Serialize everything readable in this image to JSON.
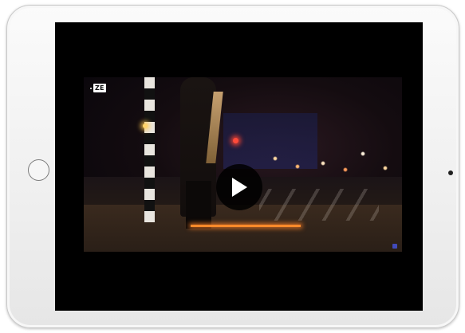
{
  "device": {
    "type": "tablet",
    "frame_color": "#f0f0f0",
    "screen_color": "#000000"
  },
  "video": {
    "channel_logo_text": "ZE",
    "play_icon": "play-icon",
    "state": "paused"
  },
  "colors": {
    "ground_light": "#ff8a2a",
    "traffic_light": "#ff4a3a",
    "play_button_bg": "#000000",
    "play_icon": "#ffffff"
  }
}
